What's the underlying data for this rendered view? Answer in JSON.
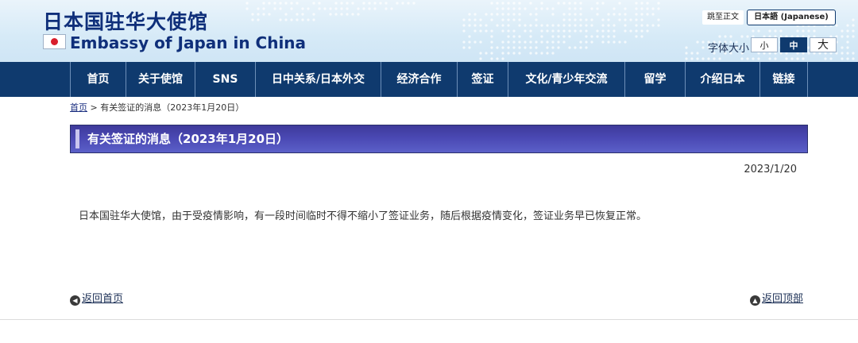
{
  "header": {
    "title_cn": "日本国驻华大使馆",
    "title_en": "Embassy of Japan in China",
    "skip_link": "跳至正文",
    "language_button": "日本語 (Japanese)",
    "font_size": {
      "label": "字体大小",
      "small": "小",
      "medium": "中",
      "large": "大",
      "selected": "中"
    }
  },
  "nav": {
    "items": [
      "首页",
      "关于使馆",
      "SNS",
      "日中关系/日本外交",
      "经济合作",
      "签证",
      "文化/青少年交流",
      "留学",
      "介绍日本",
      "链接"
    ]
  },
  "breadcrumb": {
    "home": "首页",
    "separator": ">",
    "current": "有关签证的消息（2023年1月20日）"
  },
  "article": {
    "heading": "有关签证的消息（2023年1月20日）",
    "date": "2023/1/20",
    "body": "日本国驻华大使馆，由于受疫情影响，有一段时间临时不得不缩小了签证业务，随后根据疫情变化，签证业务早已恢复正常。"
  },
  "footer": {
    "back_home": "返回首页",
    "back_top": "返回顶部"
  },
  "colors": {
    "nav_bg": "#0f3a6e",
    "title_color": "#0f2f7a",
    "heading_bar": "#4a48b3",
    "flag_red": "#d81e2c"
  }
}
